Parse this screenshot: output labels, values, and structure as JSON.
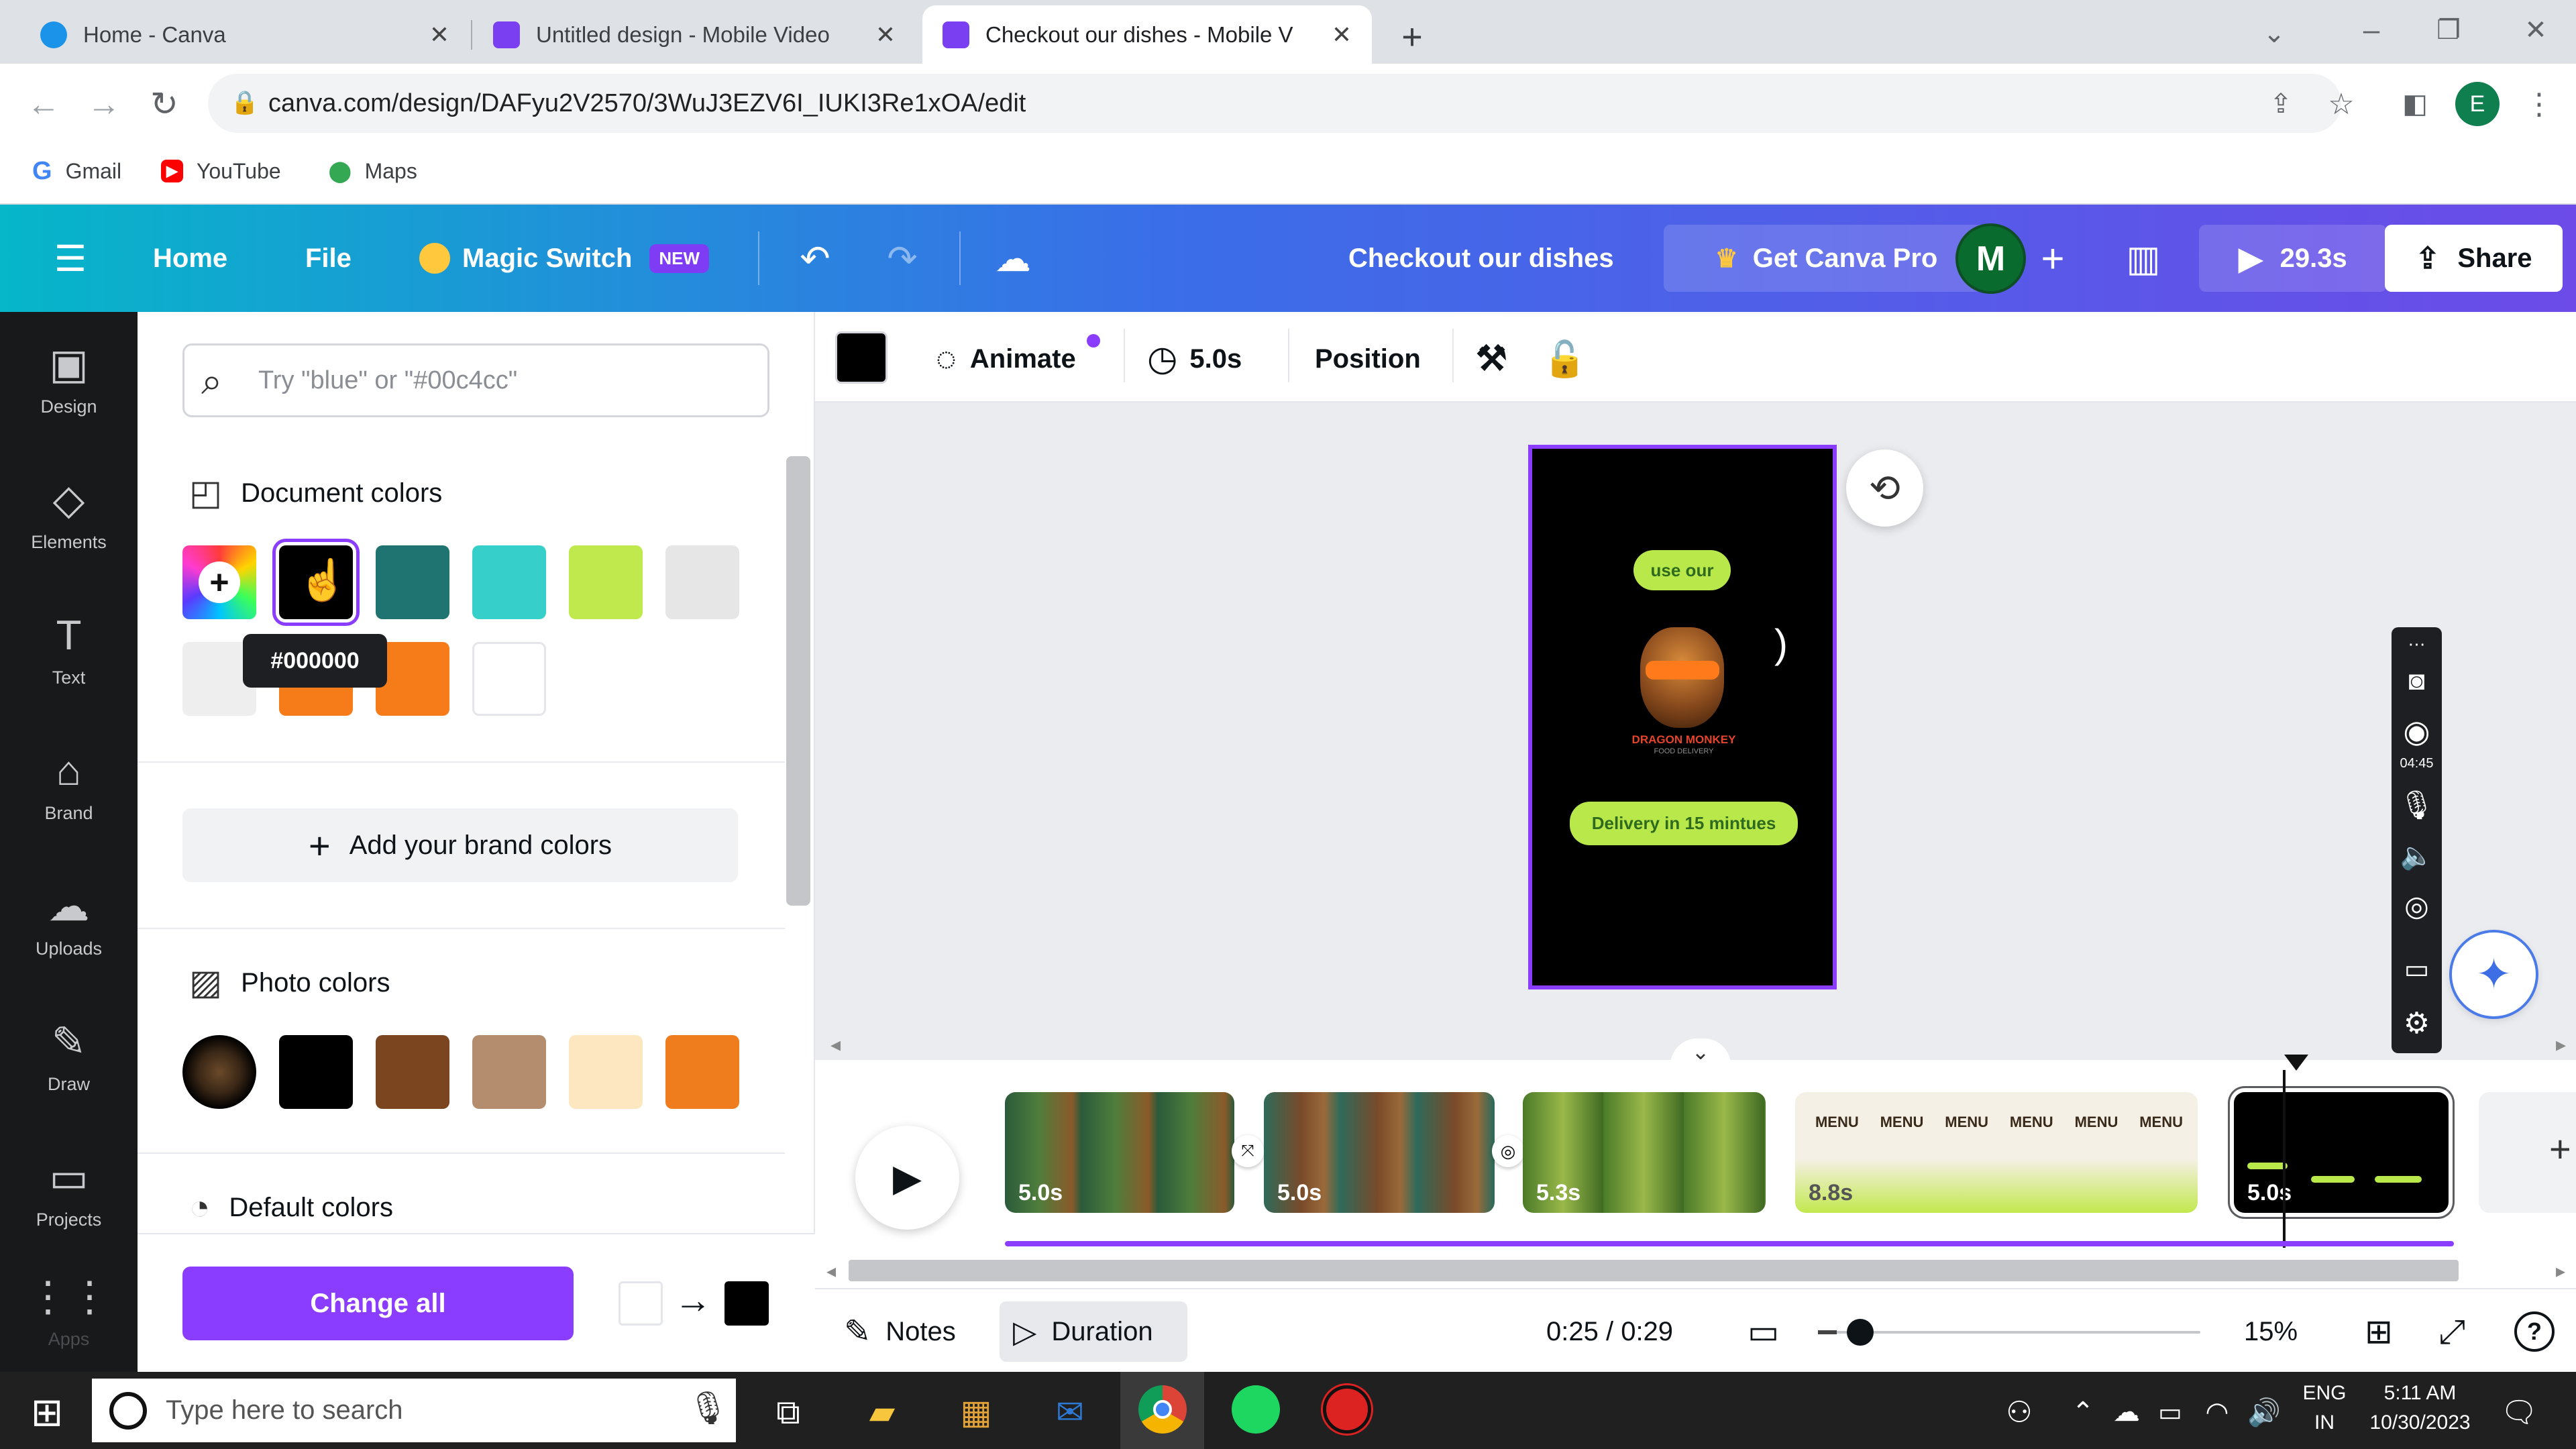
{
  "browser": {
    "tabs": [
      {
        "title": "Home - Canva",
        "active": false
      },
      {
        "title": "Untitled design - Mobile Video",
        "active": false
      },
      {
        "title": "Checkout our dishes - Mobile V",
        "active": true
      }
    ],
    "new_tab": "+",
    "url": "canva.com/design/DAFyu2V2570/3WuJ3EZV6I_IUKI3Re1xOA/edit",
    "bookmarks": [
      {
        "label": "Gmail",
        "icon": "G"
      },
      {
        "label": "YouTube",
        "icon": "▶"
      },
      {
        "label": "Maps",
        "icon": "⬤"
      }
    ],
    "profile_initial": "E"
  },
  "header": {
    "menu_icon": "☰",
    "home": "Home",
    "file": "File",
    "magic_switch": "Magic Switch",
    "new_badge": "NEW",
    "design_title": "Checkout our dishes",
    "get_pro": "Get Canva Pro",
    "avatar_initial": "M",
    "play_duration": "29.3s",
    "share": "Share",
    "accent": "#8b3dff"
  },
  "rail": [
    {
      "label": "Design",
      "icon": "▣"
    },
    {
      "label": "Elements",
      "icon": "◇"
    },
    {
      "label": "Text",
      "icon": "T"
    },
    {
      "label": "Brand",
      "icon": "⌂"
    },
    {
      "label": "Uploads",
      "icon": "☁"
    },
    {
      "label": "Draw",
      "icon": "✎"
    },
    {
      "label": "Projects",
      "icon": "▭"
    },
    {
      "label": "Apps",
      "icon": "⋮⋮"
    }
  ],
  "panel": {
    "search_placeholder": "Try \"blue\" or \"#00c4cc\"",
    "document_colors_title": "Document colors",
    "document_colors": [
      "#000000",
      "#1f7471",
      "#36cfc9",
      "#c0e94d",
      "#e6e6e6",
      "#eeeeee",
      "#f57c18",
      "#f57c18",
      "#ffffff"
    ],
    "tooltip": "#000000",
    "add_brand_colors": "Add your brand colors",
    "photo_colors_title": "Photo colors",
    "photo_colors": [
      "#000000",
      "#7b4520",
      "#b48d6e",
      "#fde7c0",
      "#ef7d1d"
    ],
    "default_colors_title": "Default colors",
    "change_all": "Change all",
    "from_color": "#ffffff",
    "to_color": "#000000"
  },
  "editor_toolbar": {
    "color": "#000000",
    "animate": "Animate",
    "duration": "5.0s",
    "position": "Position"
  },
  "page": {
    "pill_top": "use our",
    "brand_name": "DRAGON MONKEY",
    "brand_sub": "FOOD DELIVERY",
    "pill_bottom": "Delivery in 15 mintues"
  },
  "side_recorder": {
    "time": "04:45"
  },
  "timeline": {
    "clips": [
      {
        "duration": "5.0s"
      },
      {
        "duration": "5.0s"
      },
      {
        "duration": "5.3s"
      },
      {
        "duration": "8.8s"
      },
      {
        "duration": "5.0s"
      }
    ],
    "menu_word": "MENU"
  },
  "footer": {
    "notes": "Notes",
    "duration": "Duration",
    "time": "0:25 / 0:29",
    "zoom": "15%",
    "zoom_level": 0.1
  },
  "taskbar": {
    "search_placeholder": "Type here to search",
    "lang_top": "ENG",
    "lang_bottom": "IN",
    "time": "5:11 AM",
    "date": "10/30/2023"
  }
}
